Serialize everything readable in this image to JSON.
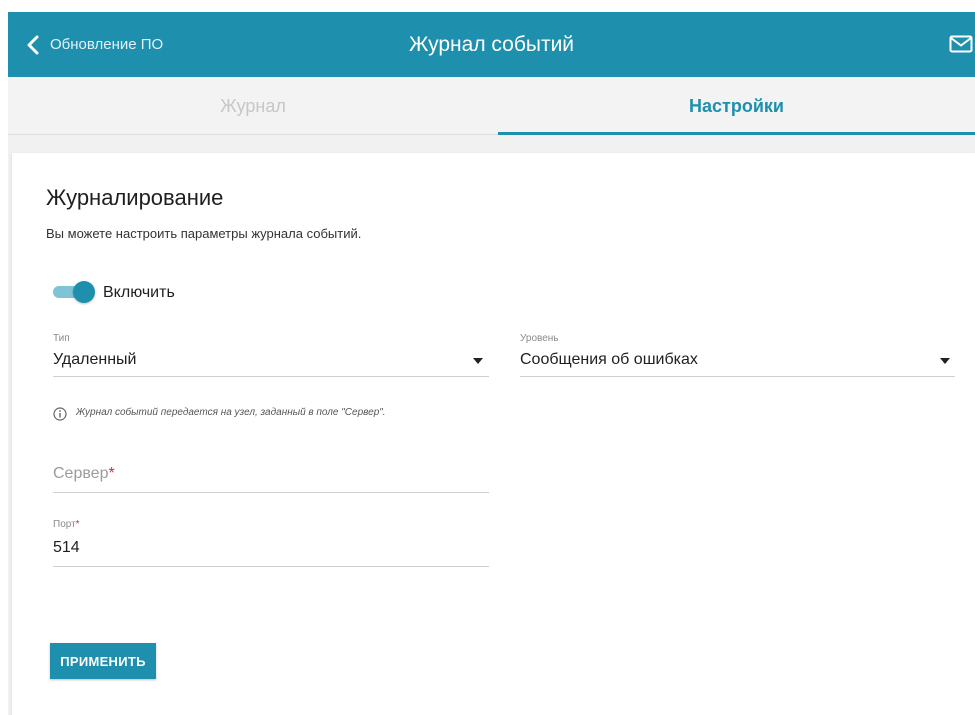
{
  "header": {
    "back_label": "Обновление ПО",
    "title": "Журнал событий",
    "mail_icon": "mail-icon",
    "background": "#1e8fad"
  },
  "tabs": [
    {
      "label": "Журнал",
      "active": false
    },
    {
      "label": "Настройки",
      "active": true
    }
  ],
  "section": {
    "title": "Журналирование",
    "description": "Вы можете настроить параметры журнала событий."
  },
  "toggle": {
    "label": "Включить",
    "on": true
  },
  "type_field": {
    "label": "Тип",
    "value": "Удаленный"
  },
  "level_field": {
    "label": "Уровень",
    "value": "Сообщения об ошибках"
  },
  "hint": {
    "icon": "info-icon",
    "text": "Журнал событий передается на узел, заданный в поле \"Сервер\"."
  },
  "server_field": {
    "placeholder": "Сервер",
    "required_mark": "*",
    "value": ""
  },
  "port_field": {
    "label": "Порт",
    "required_mark": "*",
    "value": "514"
  },
  "apply_button": {
    "label": "ПРИМЕНИТЬ"
  },
  "colors": {
    "accent": "#1e8fad",
    "toggle_track": "#7fc3d6",
    "required": "#d32f2f"
  }
}
